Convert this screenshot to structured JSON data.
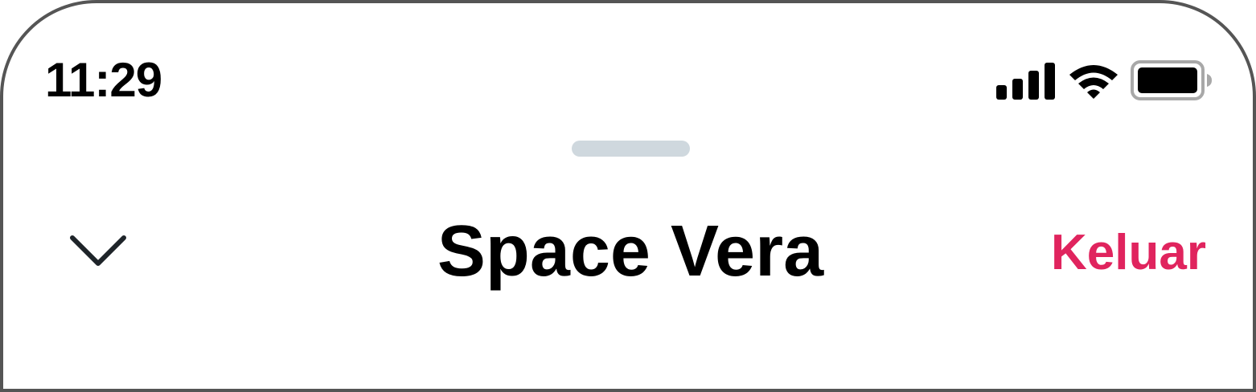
{
  "status_bar": {
    "time": "11:29",
    "icons": [
      "cellular-signal-icon",
      "wifi-icon",
      "battery-icon"
    ]
  },
  "sheet": {
    "grabber": "grabber-handle"
  },
  "nav": {
    "collapse_icon": "chevron-down-icon",
    "title": "Space Vera",
    "logout_label": "Keluar"
  },
  "colors": {
    "accent": "#e0245e",
    "text": "#000000",
    "grabber": "#cfd8de",
    "frame": "#555555"
  }
}
